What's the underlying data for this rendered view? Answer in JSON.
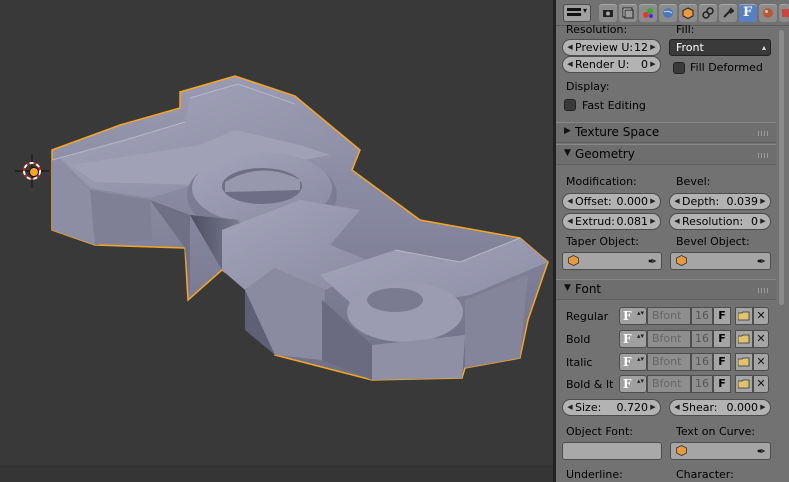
{
  "header": {
    "tabs": [
      {
        "icon": "render-icon"
      },
      {
        "icon": "render-layers-icon"
      },
      {
        "icon": "scene-icon"
      },
      {
        "icon": "world-icon"
      },
      {
        "icon": "object-icon"
      },
      {
        "icon": "constraints-icon"
      },
      {
        "icon": "modifiers-icon"
      },
      {
        "icon": "font-data-icon",
        "label": "F",
        "active": true
      },
      {
        "icon": "material-icon"
      },
      {
        "icon": "texture-icon"
      }
    ]
  },
  "shape": {
    "resolution_label": "Resolution:",
    "fill_label": "Fill:",
    "preview_u": {
      "label": "Preview U:",
      "value": "12"
    },
    "render_u": {
      "label": "Render U:",
      "value": "0"
    },
    "fill_value": "Front",
    "fill_deformed_label": "Fill Deformed",
    "display_label": "Display:",
    "fast_editing_label": "Fast Editing"
  },
  "texture_space": {
    "title": "Texture Space"
  },
  "geometry": {
    "title": "Geometry",
    "modification_label": "Modification:",
    "bevel_label": "Bevel:",
    "offset": {
      "label": "Offset:",
      "value": "0.000"
    },
    "extrude": {
      "label": "Extrud:",
      "value": "0.081"
    },
    "depth": {
      "label": "Depth:",
      "value": "0.039"
    },
    "resolution": {
      "label": "Resolution:",
      "value": "0"
    },
    "taper_label": "Taper Object:",
    "bevel_object_label": "Bevel Object:"
  },
  "font": {
    "title": "Font",
    "rows": [
      {
        "label": "Regular",
        "name": "Bfont",
        "users": "16",
        "fake": "F"
      },
      {
        "label": "Bold",
        "name": "Bfont",
        "users": "16",
        "fake": "F"
      },
      {
        "label": "Italic",
        "name": "Bfont",
        "users": "16",
        "fake": "F"
      },
      {
        "label": "Bold & It",
        "name": "Bfont",
        "users": "16",
        "fake": "F"
      }
    ],
    "size": {
      "label": "Size:",
      "value": "0.720"
    },
    "shear": {
      "label": "Shear:",
      "value": "0.000"
    },
    "object_font_label": "Object Font:",
    "text_on_curve_label": "Text on Curve:",
    "underline_label": "Underline:",
    "character_label": "Character:"
  },
  "colors": {
    "outline": "#f5a623",
    "active_tab": "#5680c2",
    "viewport_bg": "#393939",
    "panel_bg": "#727272"
  }
}
